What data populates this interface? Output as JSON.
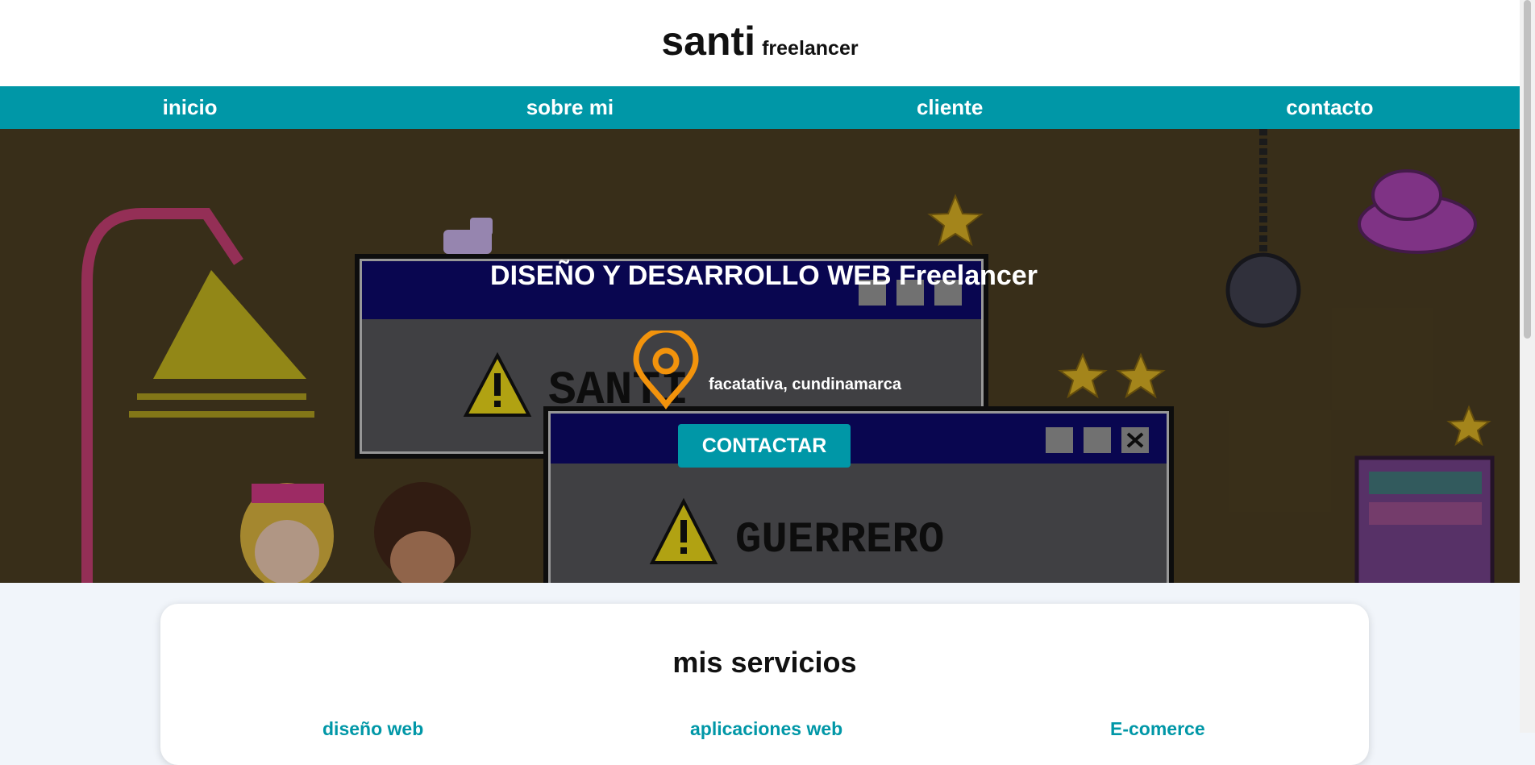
{
  "header": {
    "brand": "santi",
    "tagline": "freelancer"
  },
  "nav": {
    "items": [
      "inicio",
      "sobre mi",
      "cliente",
      "contacto"
    ]
  },
  "hero": {
    "title": "DISEÑO Y DESARROLLO WEB Freelancer",
    "location": "facatativa, cundinamarca",
    "cta": "CONTACTAR",
    "window_text_1": "SANTI",
    "window_text_2": "GUERRERO"
  },
  "services": {
    "title": "mis servicios",
    "items": [
      "diseño web",
      "aplicaciones web",
      "E-comerce"
    ]
  },
  "colors": {
    "accent": "#0097a7",
    "pin": "#f2930c",
    "hero_bg": "#45391f"
  },
  "icons": [
    "location-pin-icon",
    "minimize-icon",
    "maximize-icon",
    "close-icon",
    "warning-icon",
    "star-icon"
  ]
}
